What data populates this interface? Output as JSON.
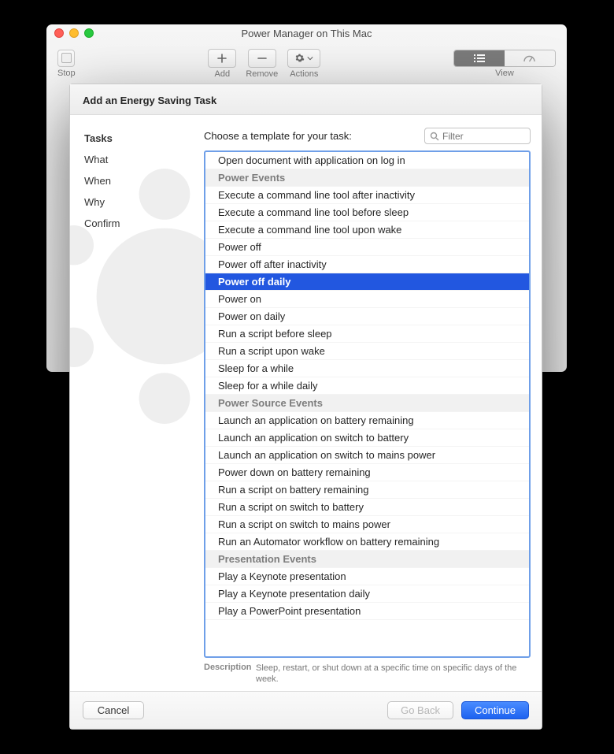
{
  "window": {
    "title": "Power Manager on This Mac",
    "stop_label": "Stop",
    "add_label": "Add",
    "remove_label": "Remove",
    "actions_label": "Actions",
    "view_label": "View"
  },
  "sheet": {
    "title": "Add an Energy Saving Task",
    "sidebar": [
      {
        "label": "Tasks",
        "bold": true
      },
      {
        "label": "What",
        "bold": false
      },
      {
        "label": "When",
        "bold": false
      },
      {
        "label": "Why",
        "bold": false
      },
      {
        "label": "Confirm",
        "bold": false
      }
    ],
    "prompt": "Choose a template for your task:",
    "filter_placeholder": "Filter",
    "groups": [
      {
        "header": null,
        "items": [
          "Open document with application on log in"
        ]
      },
      {
        "header": "Power Events",
        "items": [
          "Execute a command line tool after inactivity",
          "Execute a command line tool before sleep",
          "Execute a command line tool upon wake",
          "Power off",
          "Power off after inactivity",
          "Power off daily",
          "Power on",
          "Power on daily",
          "Run a script before sleep",
          "Run a script upon wake",
          "Sleep for a while",
          "Sleep for a while daily"
        ]
      },
      {
        "header": "Power Source Events",
        "items": [
          "Launch an application on battery remaining",
          "Launch an application on switch to battery",
          "Launch an application on switch to mains power",
          "Power down on battery remaining",
          "Run a script on battery remaining",
          "Run a script on switch to battery",
          "Run a script on switch to mains power",
          "Run an Automator workflow on battery remaining"
        ]
      },
      {
        "header": "Presentation Events",
        "items": [
          "Play a Keynote presentation",
          "Play a Keynote presentation daily",
          "Play a PowerPoint presentation"
        ]
      }
    ],
    "selected": "Power off daily",
    "description_label": "Description",
    "description_text": "Sleep, restart, or shut down at a specific time on specific days of the week.",
    "cancel_label": "Cancel",
    "goback_label": "Go Back",
    "continue_label": "Continue"
  }
}
